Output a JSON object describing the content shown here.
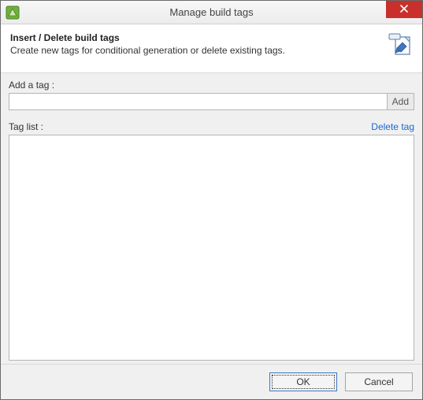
{
  "titlebar": {
    "title": "Manage build tags"
  },
  "header": {
    "title": "Insert / Delete build tags",
    "description": "Create new tags for conditional generation or delete existing tags."
  },
  "form": {
    "add_label": "Add a tag :",
    "add_input_value": "",
    "add_button": "Add",
    "list_label": "Tag list :",
    "delete_link": "Delete tag",
    "tags": []
  },
  "footer": {
    "ok": "OK",
    "cancel": "Cancel"
  }
}
